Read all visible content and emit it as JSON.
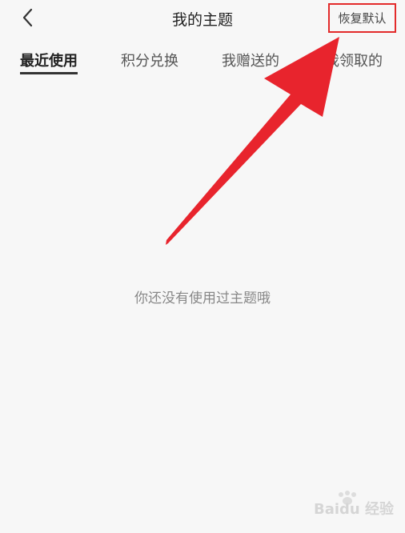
{
  "header": {
    "title": "我的主题",
    "restore_label": "恢复默认",
    "back_icon": "chevron-left-icon"
  },
  "tabs": [
    {
      "label": "最近使用",
      "active": true
    },
    {
      "label": "积分兑换",
      "active": false
    },
    {
      "label": "我赠送的",
      "active": false
    },
    {
      "label": "我领取的",
      "active": false
    }
  ],
  "empty_state": {
    "message": "你还没有使用过主题哦"
  },
  "annotation": {
    "arrow_color": "#e8242d",
    "highlight_color": "#e32b2b"
  },
  "watermark": {
    "text": "Baidu 经验"
  }
}
